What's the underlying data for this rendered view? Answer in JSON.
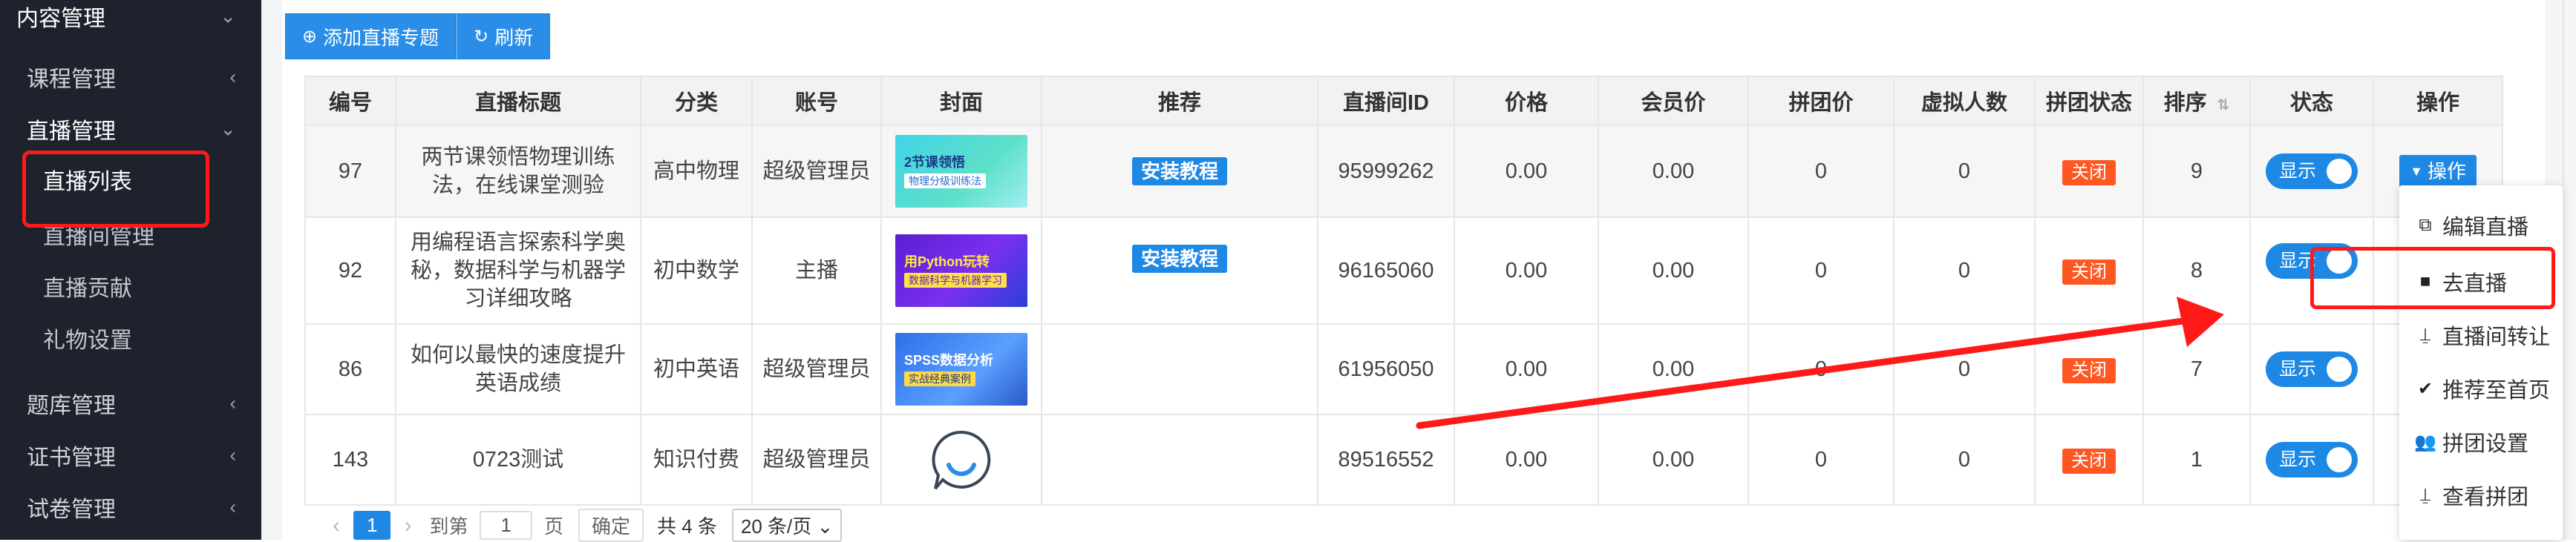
{
  "sidebar": {
    "top": {
      "label": "内容管理"
    },
    "groups": [
      {
        "label": "课程管理"
      },
      {
        "label": "直播管理"
      },
      {
        "label": "题库管理"
      },
      {
        "label": "证书管理"
      },
      {
        "label": "试卷管理"
      }
    ],
    "live_items": [
      {
        "label": "直播列表"
      },
      {
        "label": "直播间管理"
      },
      {
        "label": "直播贡献"
      },
      {
        "label": "礼物设置"
      }
    ]
  },
  "toolbar": {
    "add_label": "添加直播专题",
    "refresh_label": "刷新"
  },
  "table": {
    "headers": [
      "编号",
      "直播标题",
      "分类",
      "账号",
      "封面",
      "推荐",
      "直播间ID",
      "价格",
      "会员价",
      "拼团价",
      "虚拟人数",
      "拼团状态",
      "排序",
      "状态",
      "操作"
    ],
    "rows": [
      {
        "id": "97",
        "title": "两节课领悟物理训练法，在线课堂测验",
        "category": "高中物理",
        "account": "超级管理员",
        "cover_line1": "2节课领悟",
        "cover_line2": "物理分级训练法",
        "recommend": "安装教程",
        "room_id": "95999262",
        "price": "0.00",
        "member_price": "0.00",
        "group_price": "0",
        "virtual": "0",
        "group_status": "关闭",
        "sort": "9",
        "status": "显示",
        "op": "操作"
      },
      {
        "id": "92",
        "title": "用编程语言探索科学奥秘，数据科学与机器学习详细攻略",
        "category": "初中数学",
        "account": "主播",
        "cover_line1": "用Python玩转",
        "cover_line2": "数据科学与机器学习",
        "recommend": "安装教程",
        "room_id": "96165060",
        "price": "0.00",
        "member_price": "0.00",
        "group_price": "0",
        "virtual": "0",
        "group_status": "关闭",
        "sort": "8",
        "status": "显示",
        "op": ""
      },
      {
        "id": "86",
        "title": "如何以最快的速度提升英语成绩",
        "category": "初中英语",
        "account": "超级管理员",
        "cover_line1": "SPSS数据分析",
        "cover_line2": "实战经典案例",
        "recommend": "",
        "room_id": "61956050",
        "price": "0.00",
        "member_price": "0.00",
        "group_price": "0",
        "virtual": "0",
        "group_status": "关闭",
        "sort": "7",
        "status": "显示",
        "op": ""
      },
      {
        "id": "143",
        "title": "0723测试",
        "category": "知识付费",
        "account": "超级管理员",
        "cover_line1": "",
        "cover_line2": "",
        "recommend": "",
        "room_id": "89516552",
        "price": "0.00",
        "member_price": "0.00",
        "group_price": "0",
        "virtual": "0",
        "group_status": "关闭",
        "sort": "1",
        "status": "显示",
        "op": ""
      }
    ]
  },
  "pagination": {
    "current": "1",
    "goto_label": "到第",
    "goto_value": "1",
    "page_label": "页",
    "confirm_label": "确定",
    "total_label": "共 4 条",
    "page_size": "20 条/页"
  },
  "dropdown": {
    "items": [
      {
        "label": "编辑直播",
        "icon": "copy-icon"
      },
      {
        "label": "去直播",
        "icon": "video-icon"
      },
      {
        "label": "直播间转让",
        "icon": "transfer-icon"
      },
      {
        "label": "推荐至首页",
        "icon": "check-circle-icon"
      },
      {
        "label": "拼团设置",
        "icon": "users-icon"
      },
      {
        "label": "查看拼团",
        "icon": "transfer-icon"
      }
    ]
  },
  "colors": {
    "accent": "#1e88e5",
    "sidebar": "#1e222d",
    "highlight": "#ff1a1a",
    "tag_red": "#ff5722"
  }
}
